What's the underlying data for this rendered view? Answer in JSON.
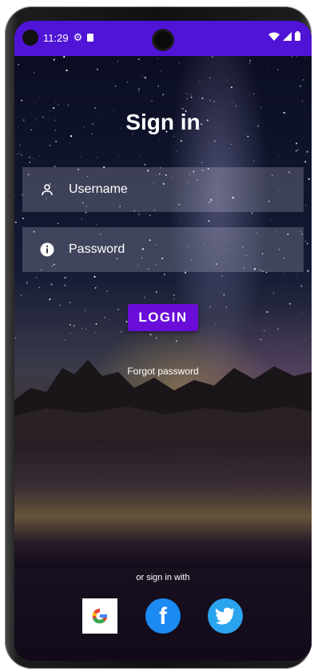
{
  "status_bar": {
    "time": "11:29",
    "icons_left": [
      "settings-gear-icon",
      "sd-card-icon"
    ],
    "icons_right": [
      "wifi-icon",
      "signal-icon",
      "battery-icon"
    ],
    "background_color": "#4f14d6"
  },
  "screen": {
    "title": "Sign in",
    "username_placeholder": "Username",
    "password_placeholder": "Password",
    "login_label": "LOGIN",
    "forgot_label": "Forgot password",
    "alt_signin_label": "or sign in with",
    "social_providers": [
      "google",
      "facebook",
      "twitter"
    ],
    "accent_color": "#6a0dd8"
  }
}
